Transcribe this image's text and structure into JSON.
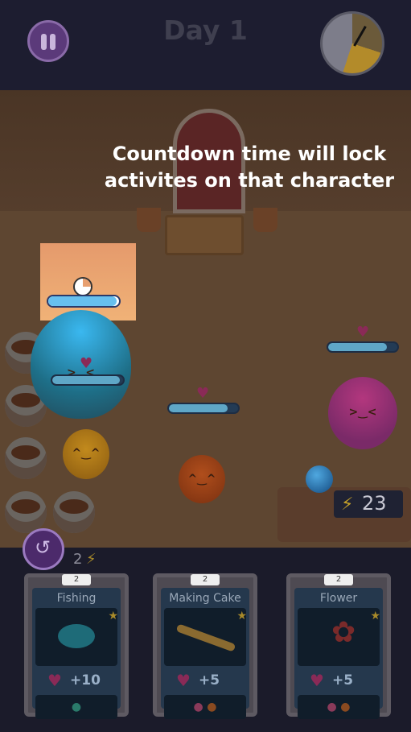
{
  "header": {
    "day_label": "Day 1"
  },
  "tutorial": {
    "line1": "Countdown time will lock",
    "line2": "activites on that character"
  },
  "energy": {
    "value": "23",
    "icon": "bolt-icon"
  },
  "moves": {
    "count": "2",
    "icon": "bolt-icon"
  },
  "status_bars": {
    "highlighted": 0.97,
    "teal": 0.95,
    "middle": 0.85,
    "pink": 0.85
  },
  "cards": [
    {
      "level": "2",
      "title": "Fishing",
      "gain": "+10",
      "icon": "fish-icon"
    },
    {
      "level": "2",
      "title": "Making Cake",
      "gain": "+5",
      "icon": "rolling-pin-icon"
    },
    {
      "level": "2",
      "title": "Flower",
      "gain": "+5",
      "icon": "rose-icon"
    }
  ],
  "colors": {
    "accent": "#5b3a7a",
    "bar": "#5fa7c7",
    "heart": "#c0306e"
  }
}
